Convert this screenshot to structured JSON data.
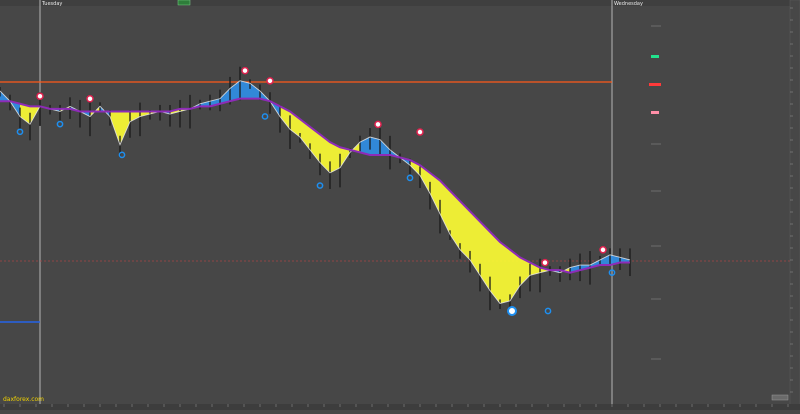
{
  "header": {
    "symbol_text": "",
    "button_label": ""
  },
  "sessions": [
    {
      "label": "Tuesday"
    },
    {
      "label": "Wednesday"
    }
  ],
  "watermark": "daxforex.com",
  "zoom_label": "",
  "colors": {
    "background": "#474747",
    "price_bars": "#1a1a1a",
    "price_highlight": "#e8e8e8",
    "down_ribbon": "#ffff33",
    "up_ribbon": "#2f8fe8",
    "moving_average": "#8e2bb8",
    "resistance_line": "#ff5a1a",
    "current_price_line": "#a84646",
    "support_marker": "#2563e8",
    "session_separator": "#b5b5b5",
    "high_marker": "#e0224f",
    "low_marker": "#1e8ff0",
    "label_green": "#22e38d",
    "label_red": "#ff3a3a",
    "label_pink": "#ff8fa8",
    "watermark": "#f2d300"
  },
  "chart_data": {
    "type": "line",
    "title": "",
    "xlabel": "",
    "ylabel": "",
    "grid": false,
    "legend": "none",
    "ylim": [
      0,
      100
    ],
    "x": [
      0,
      10,
      20,
      30,
      40,
      50,
      60,
      70,
      80,
      90,
      100,
      110,
      120,
      130,
      140,
      150,
      160,
      170,
      180,
      190,
      200,
      210,
      220,
      230,
      240,
      250,
      260,
      270,
      280,
      290,
      300,
      310,
      320,
      330,
      340,
      350,
      360,
      370,
      380,
      390,
      400,
      410,
      420,
      430,
      440,
      450,
      460,
      470,
      480,
      490,
      500,
      510,
      520,
      530,
      540,
      550,
      560,
      570,
      580,
      590,
      600,
      610,
      620,
      630
    ],
    "series": [
      {
        "name": "",
        "values": [
          84,
          80,
          74,
          71,
          78,
          77,
          76,
          78,
          76,
          74,
          78,
          74,
          63,
          72,
          74,
          75,
          76,
          75,
          76,
          77,
          79,
          80,
          81,
          85,
          88,
          87,
          84,
          80,
          74,
          69,
          66,
          61,
          56,
          52,
          54,
          60,
          64,
          66,
          65,
          61,
          58,
          55,
          51,
          44,
          36,
          28,
          22,
          18,
          12,
          6,
          1,
          2,
          8,
          12,
          13,
          14,
          13,
          15,
          16,
          16,
          18,
          20,
          19,
          18
        ]
      },
      {
        "name": "",
        "values": [
          80,
          80,
          79,
          78,
          78,
          77,
          77,
          77,
          76,
          76,
          76,
          76,
          76,
          76,
          76,
          76,
          76,
          76,
          77,
          77,
          78,
          78,
          79,
          80,
          81,
          81,
          81,
          80,
          78,
          76,
          73,
          70,
          67,
          64,
          62,
          61,
          60,
          59,
          59,
          59,
          58,
          57,
          55,
          52,
          49,
          45,
          41,
          37,
          33,
          29,
          25,
          22,
          19,
          17,
          15,
          14,
          14,
          13,
          14,
          15,
          16,
          16,
          17,
          17
        ]
      }
    ],
    "levels": [
      {
        "name": "",
        "value": 77,
        "type": "resistance"
      },
      {
        "name": "",
        "value": 15,
        "type": "current_price"
      }
    ],
    "high_markers": [
      {
        "x": 40,
        "y": 80
      },
      {
        "x": 90,
        "y": 79
      },
      {
        "x": 245,
        "y": 90
      },
      {
        "x": 270,
        "y": 86
      },
      {
        "x": 378,
        "y": 69
      },
      {
        "x": 420,
        "y": 66
      },
      {
        "x": 545,
        "y": 15
      },
      {
        "x": 603,
        "y": 20
      }
    ],
    "low_markers": [
      {
        "x": 20,
        "y": 70
      },
      {
        "x": 60,
        "y": 73
      },
      {
        "x": 122,
        "y": 61
      },
      {
        "x": 265,
        "y": 76
      },
      {
        "x": 320,
        "y": 49
      },
      {
        "x": 410,
        "y": 52
      },
      {
        "x": 512,
        "y": 0
      },
      {
        "x": 548,
        "y": 0
      },
      {
        "x": 612,
        "y": 15
      }
    ]
  }
}
